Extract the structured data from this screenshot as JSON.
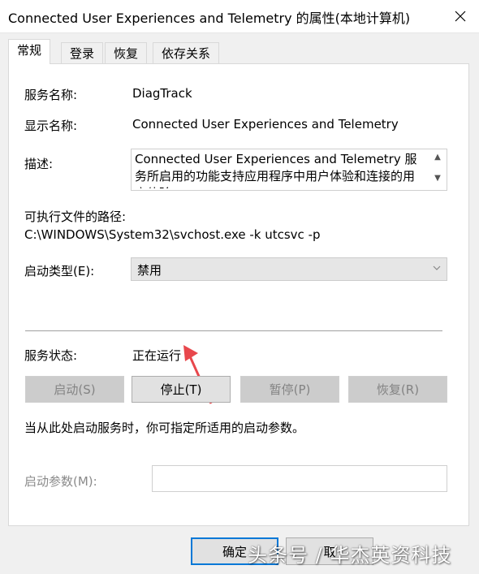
{
  "window": {
    "title": "Connected User Experiences and Telemetry 的属性(本地计算机)"
  },
  "tabs": [
    {
      "label": "常规",
      "active": true
    },
    {
      "label": "登录"
    },
    {
      "label": "恢复"
    },
    {
      "label": "依存关系"
    }
  ],
  "general": {
    "service_name_label": "服务名称:",
    "service_name": "DiagTrack",
    "display_name_label": "显示名称:",
    "display_name": "Connected User Experiences and Telemetry",
    "description_label": "描述:",
    "description": "Connected User Experiences and Telemetry 服务所启用的功能支持应用程序中用户体验和连接的用户体验",
    "exe_path_label": "可执行文件的路径:",
    "exe_path": "C:\\WINDOWS\\System32\\svchost.exe -k utcsvc -p",
    "startup_type_label": "启动类型(E):",
    "startup_type": "禁用",
    "status_label": "服务状态:",
    "status": "正在运行",
    "buttons": {
      "start": "启动(S)",
      "stop": "停止(T)",
      "pause": "暂停(P)",
      "resume": "恢复(R)"
    },
    "hint": "当从此处启动服务时，你可指定所适用的启动参数。",
    "start_params_label": "启动参数(M):",
    "start_params_value": ""
  },
  "footer": {
    "ok": "确定",
    "cancel": "取"
  },
  "watermark": "头条号 / 华杰英资科技",
  "colors": {
    "accent": "#0078d7",
    "annotation_arrow": "#e8474c"
  },
  "icons": {
    "close": "close-icon",
    "chevron": "chevron-down-icon",
    "arrow": "annotation-arrow"
  }
}
